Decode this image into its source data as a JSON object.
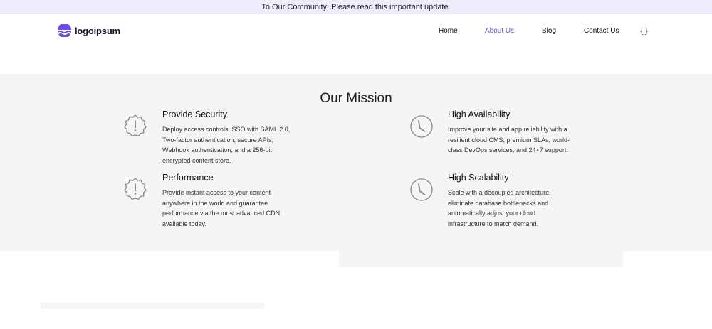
{
  "announcement": {
    "text": "To Our Community: Please read this important update."
  },
  "header": {
    "logo_text": "logoipsum",
    "nav": [
      {
        "label": "Home",
        "active": false
      },
      {
        "label": "About Us",
        "active": true
      },
      {
        "label": "Blog",
        "active": false
      },
      {
        "label": "Contact Us",
        "active": false
      }
    ],
    "code_icon": "{}"
  },
  "colors": {
    "accent": "#6b4ee6",
    "announcement_bg": "#efedfb",
    "section_bg": "#f5f5f5",
    "icon_stroke": "#8c8780"
  },
  "mission": {
    "title": "Our Mission",
    "features": [
      {
        "icon": "warning-badge-icon",
        "title": "Provide Security",
        "description": [
          "Deploy access controls, SSO with SAML 2.0,",
          "Two-factor authentication, secure APIs,",
          "Webhook authentication, and a 256-bit",
          "encrypted content store."
        ]
      },
      {
        "icon": "clock-icon",
        "title": "High Availability",
        "description": [
          "Improve your site and app reliability with a",
          "resilient cloud CMS, premium SLAs, world-",
          "class DevOps services, and 24×7 support."
        ]
      },
      {
        "icon": "warning-badge-icon",
        "title": "Performance",
        "description": [
          "Provide instant access to your content",
          "anywhere in the world and guarantee",
          "performance via the most advanced CDN",
          "available today."
        ]
      },
      {
        "icon": "clock-icon",
        "title": "High Scalability",
        "description": [
          "Scale with a decoupled architecture,",
          "eliminate database bottlenecks and",
          "automatically adjust your cloud",
          "infrastructure to match demand."
        ]
      }
    ]
  }
}
